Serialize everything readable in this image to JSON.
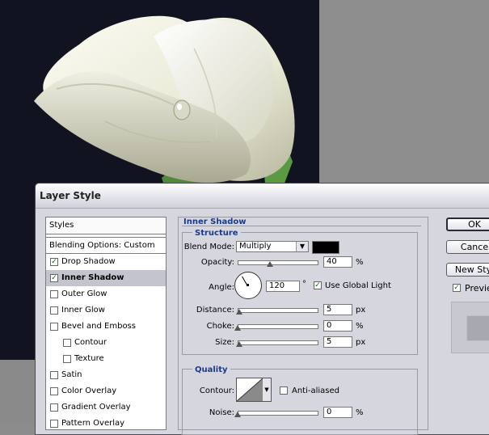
{
  "dialog": {
    "title": "Layer Style"
  },
  "styles_panel": {
    "header": "Styles",
    "blending_options": "Blending Options: Custom",
    "items": [
      {
        "label": "Drop Shadow",
        "checked": true,
        "selected": false,
        "indent": false
      },
      {
        "label": "Inner Shadow",
        "checked": true,
        "selected": true,
        "indent": false
      },
      {
        "label": "Outer Glow",
        "checked": false,
        "selected": false,
        "indent": false
      },
      {
        "label": "Inner Glow",
        "checked": false,
        "selected": false,
        "indent": false
      },
      {
        "label": "Bevel and Emboss",
        "checked": false,
        "selected": false,
        "indent": false
      },
      {
        "label": "Contour",
        "checked": false,
        "selected": false,
        "indent": true
      },
      {
        "label": "Texture",
        "checked": false,
        "selected": false,
        "indent": true
      },
      {
        "label": "Satin",
        "checked": false,
        "selected": false,
        "indent": false
      },
      {
        "label": "Color Overlay",
        "checked": false,
        "selected": false,
        "indent": false
      },
      {
        "label": "Gradient Overlay",
        "checked": false,
        "selected": false,
        "indent": false
      },
      {
        "label": "Pattern Overlay",
        "checked": false,
        "selected": false,
        "indent": false
      }
    ]
  },
  "inner_shadow": {
    "heading": "Inner Shadow",
    "structure": {
      "heading": "Structure",
      "blend_mode_label": "Blend Mode:",
      "blend_mode_value": "Multiply",
      "shadow_color": "#000000",
      "opacity_label": "Opacity:",
      "opacity_value": "40",
      "opacity_unit": "%",
      "opacity_fraction": 0.4,
      "angle_label": "Angle:",
      "angle_value": "120",
      "angle_unit": "°",
      "angle_degrees": 120,
      "use_global_light_label": "Use Global Light",
      "use_global_light_checked": true,
      "distance_label": "Distance:",
      "distance_value": "5",
      "distance_unit": "px",
      "distance_fraction": 0.02,
      "choke_label": "Choke:",
      "choke_value": "0",
      "choke_unit": "%",
      "choke_fraction": 0,
      "size_label": "Size:",
      "size_value": "5",
      "size_unit": "px",
      "size_fraction": 0.02
    },
    "quality": {
      "heading": "Quality",
      "contour_label": "Contour:",
      "anti_aliased_label": "Anti-aliased",
      "anti_aliased_checked": false,
      "noise_label": "Noise:",
      "noise_value": "0",
      "noise_unit": "%",
      "noise_fraction": 0
    }
  },
  "buttons": {
    "ok": "OK",
    "cancel": "Cance",
    "new_style": "New Styl",
    "preview_label": "Previe",
    "preview_checked": true
  }
}
